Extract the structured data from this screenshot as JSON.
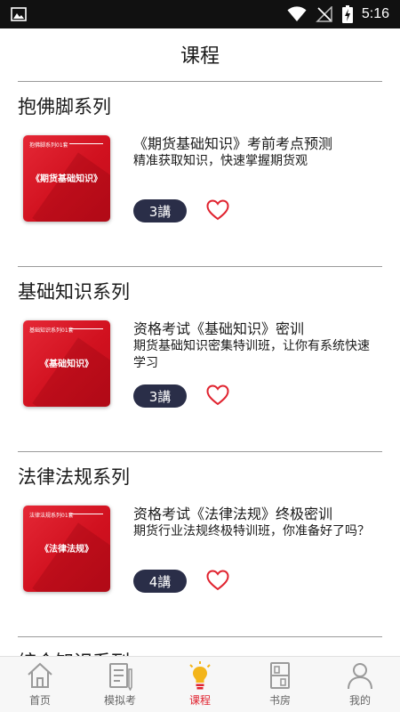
{
  "status_bar": {
    "time": "5:16"
  },
  "header": {
    "title": "课程"
  },
  "sections": [
    {
      "title": "抱佛脚系列",
      "course": {
        "thumb_series": "抱佛脚系列01套",
        "thumb_name": "《期货基础知识》",
        "title": "《期货基础知识》考前考点预测",
        "description": "精准获取知识，快速掌握期货观",
        "lessons": "3講"
      }
    },
    {
      "title": "基础知识系列",
      "course": {
        "thumb_series": "基础知识系列01套",
        "thumb_name": "《基础知识》",
        "title": "资格考试《基础知识》密训",
        "description": "期货基础知识密集特训班，让你有系统快速学习",
        "lessons": "3講"
      }
    },
    {
      "title": "法律法规系列",
      "course": {
        "thumb_series": "法律法规系列01套",
        "thumb_name": "《法律法规》",
        "title": "资格考试《法律法规》终极密训",
        "description": "期货行业法规终极特训班，你准备好了吗？",
        "lessons": "4講"
      }
    }
  ],
  "next_section_peek": "综合知识系列",
  "tabs": [
    {
      "label": "首页",
      "icon": "home-icon",
      "active": false
    },
    {
      "label": "模拟考",
      "icon": "exam-icon",
      "active": false
    },
    {
      "label": "课程",
      "icon": "lightbulb-icon",
      "active": true
    },
    {
      "label": "书房",
      "icon": "bookshelf-icon",
      "active": false
    },
    {
      "label": "我的",
      "icon": "profile-icon",
      "active": false
    }
  ],
  "colors": {
    "accent": "#e0232f",
    "badge": "#2a2e48",
    "thumb": "#d81b2a"
  }
}
